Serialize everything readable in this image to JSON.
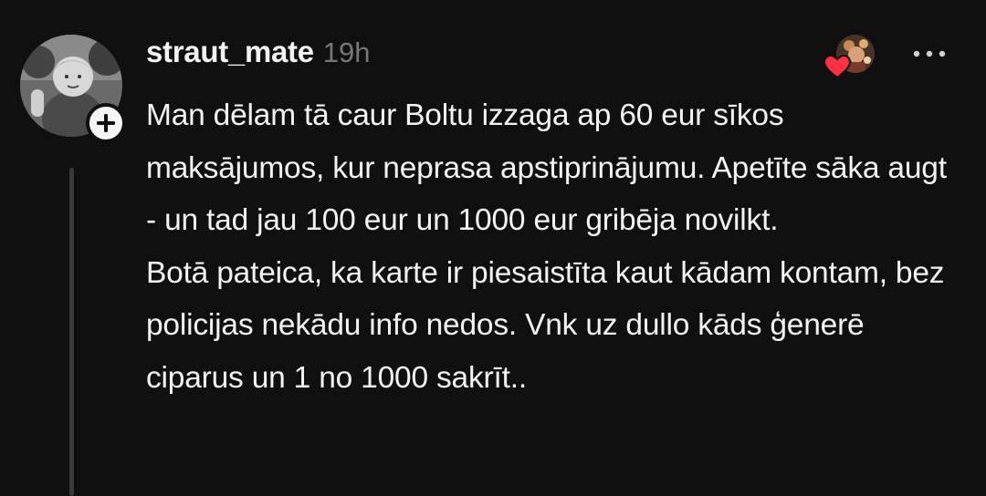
{
  "post": {
    "username": "straut_mate",
    "timestamp": "19h",
    "body": "Man dēlam tā caur Boltu izzaga ap 60 eur sīkos maksājumos, kur neprasa apstiprinājumu. Apetīte sāka augt - un tad jau 100 eur un 1000 eur gribēja novilkt.\nBotā pateica, ka karte ir piesaistīta kaut kādam kontam, bez policijas nekādu info nedos. Vnk uz dullo kāds ģenerē ciparus un 1 no 1000 sakrīt.."
  },
  "icons": {
    "follow": "plus-icon",
    "like": "heart-icon",
    "more": "more-dots-icon"
  },
  "colors": {
    "background": "#101010",
    "text": "#f3f3f3",
    "muted": "#777777",
    "heart": "#ff3040",
    "thread_line": "#3a3a3a"
  }
}
